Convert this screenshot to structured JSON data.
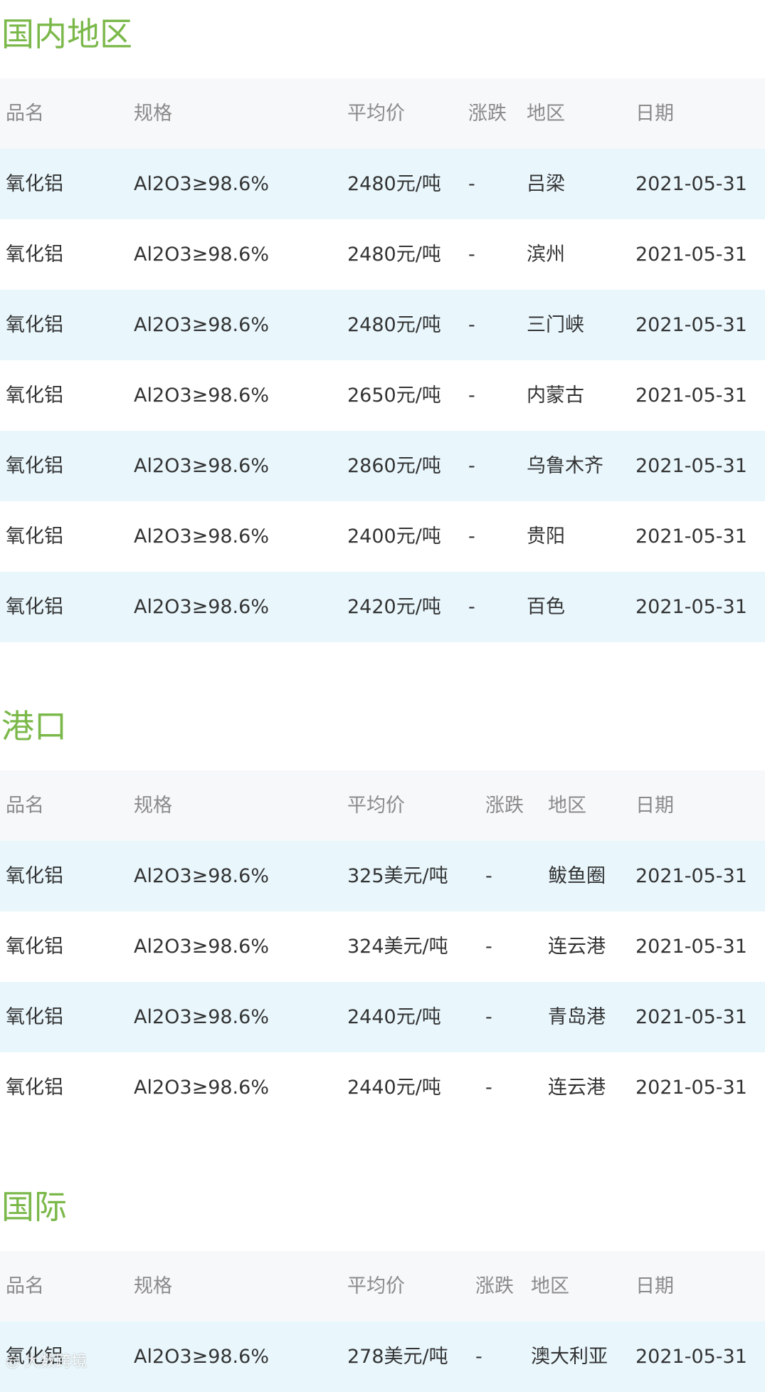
{
  "sections": [
    {
      "title": "国内地区",
      "headers": [
        "品名",
        "规格",
        "平均价",
        "涨跌",
        "地区",
        "日期"
      ],
      "rows": [
        [
          "氧化铝",
          "Al2O3≥98.6%",
          "2480元/吨",
          "-",
          "吕梁",
          "2021-05-31"
        ],
        [
          "氧化铝",
          "Al2O3≥98.6%",
          "2480元/吨",
          "-",
          "滨州",
          "2021-05-31"
        ],
        [
          "氧化铝",
          "Al2O3≥98.6%",
          "2480元/吨",
          "-",
          "三门峡",
          "2021-05-31"
        ],
        [
          "氧化铝",
          "Al2O3≥98.6%",
          "2650元/吨",
          "-",
          "内蒙古",
          "2021-05-31"
        ],
        [
          "氧化铝",
          "Al2O3≥98.6%",
          "2860元/吨",
          "-",
          "乌鲁木齐",
          "2021-05-31"
        ],
        [
          "氧化铝",
          "Al2O3≥98.6%",
          "2400元/吨",
          "-",
          "贵阳",
          "2021-05-31"
        ],
        [
          "氧化铝",
          "Al2O3≥98.6%",
          "2420元/吨",
          "-",
          "百色",
          "2021-05-31"
        ]
      ]
    },
    {
      "title": "港口",
      "headers": [
        "品名",
        "规格",
        "平均价",
        "涨跌",
        "地区",
        "日期"
      ],
      "rows": [
        [
          "氧化铝",
          "Al2O3≥98.6%",
          "325美元/吨",
          "-",
          "鲅鱼圈",
          "2021-05-31"
        ],
        [
          "氧化铝",
          "Al2O3≥98.6%",
          "324美元/吨",
          "-",
          "连云港",
          "2021-05-31"
        ],
        [
          "氧化铝",
          "Al2O3≥98.6%",
          "2440元/吨",
          "-",
          "青岛港",
          "2021-05-31"
        ],
        [
          "氧化铝",
          "Al2O3≥98.6%",
          "2440元/吨",
          "-",
          "连云港",
          "2021-05-31"
        ]
      ]
    },
    {
      "title": "国际",
      "headers": [
        "品名",
        "规格",
        "平均价",
        "涨跌",
        "地区",
        "日期"
      ],
      "rows": [
        [
          "氧化铝",
          "Al2O3≥98.6%",
          "278美元/吨",
          "-",
          "澳大利亚",
          "2021-05-31"
        ]
      ]
    }
  ],
  "watermark": "大数跨境"
}
